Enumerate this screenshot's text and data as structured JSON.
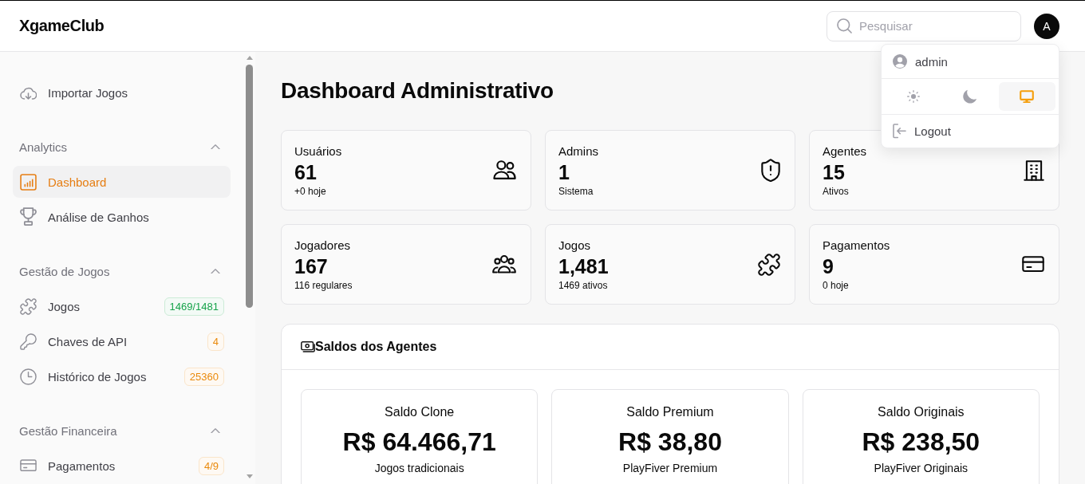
{
  "header": {
    "logo": "XgameClub",
    "search": {
      "placeholder": "Pesquisar"
    },
    "avatar": {
      "initial": "A"
    }
  },
  "user_menu": {
    "open": true,
    "username": "admin",
    "themes": [
      {
        "kind": "light",
        "selected": false
      },
      {
        "kind": "dark",
        "selected": false
      },
      {
        "kind": "system",
        "selected": true
      }
    ],
    "logout": "Logout"
  },
  "sidebar": {
    "top_items": [
      {
        "label": "Importar Jogos",
        "kind": "import",
        "selected": false
      }
    ],
    "sections": [
      {
        "title": "Analytics",
        "expanded": true,
        "items": [
          {
            "label": "Dashboard",
            "kind": "dashboard",
            "selected": true
          },
          {
            "label": "Análise de Ganhos",
            "kind": "analysis",
            "selected": false
          }
        ]
      },
      {
        "title": "Gestão de Jogos",
        "expanded": true,
        "items": [
          {
            "label": "Jogos",
            "kind": "games",
            "selected": false,
            "badge": {
              "text": "1469/1481",
              "color": "#16a34a"
            }
          },
          {
            "label": "Chaves de API",
            "kind": "api_keys",
            "selected": false,
            "badge": {
              "text": "4",
              "color": "#ea8a0c"
            }
          },
          {
            "label": "Histórico de Jogos",
            "kind": "history",
            "selected": false,
            "badge": {
              "text": "25360",
              "color": "#ea8a0c"
            }
          }
        ]
      },
      {
        "title": "Gestão Financeira",
        "expanded": true,
        "items": [
          {
            "label": "Pagamentos",
            "kind": "payments",
            "selected": false,
            "badge": {
              "text": "4/9",
              "color": "#ea8a0c"
            }
          }
        ]
      }
    ]
  },
  "main": {
    "title": "Dashboard Administrativo",
    "stats": [
      {
        "kind": "users",
        "label": "Usuários",
        "value": "61",
        "note": "+0 hoje"
      },
      {
        "kind": "admins",
        "label": "Admins",
        "value": "1",
        "note": "Sistema"
      },
      {
        "kind": "agents",
        "label": "Agentes",
        "value": "15",
        "note": "Ativos"
      },
      {
        "kind": "players",
        "label": "Jogadores",
        "value": "167",
        "note": "116 regulares"
      },
      {
        "kind": "games",
        "label": "Jogos",
        "value": "1,481",
        "note": "1469 ativos"
      },
      {
        "kind": "payments",
        "label": "Pagamentos",
        "value": "9",
        "note": "0 hoje"
      }
    ],
    "balances_panel": {
      "title": "Saldos dos Agentes",
      "balances": [
        {
          "label": "Saldo Clone",
          "amount": "R$ 64.466,71",
          "description": "Jogos tradicionais"
        },
        {
          "label": "Saldo Premium",
          "amount": "R$ 38,80",
          "description": "PlayFiver Premium"
        },
        {
          "label": "Saldo Originais",
          "amount": "R$ 238,50",
          "description": "PlayFiver Originais"
        }
      ]
    }
  }
}
